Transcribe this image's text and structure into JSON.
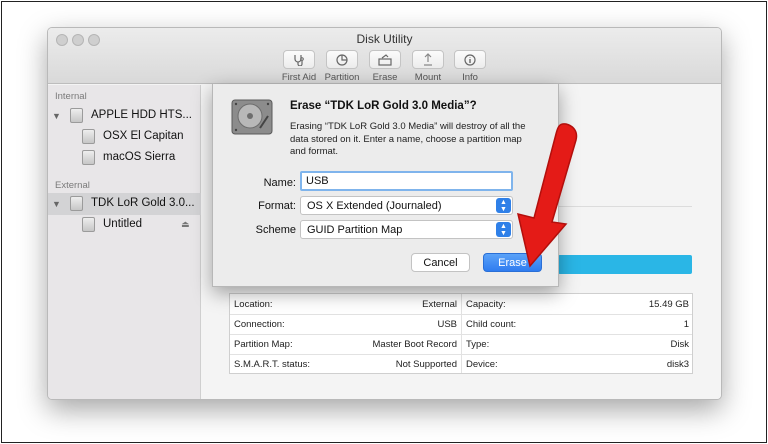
{
  "window": {
    "title": "Disk Utility"
  },
  "toolbar": {
    "buttons": [
      {
        "label": "First Aid",
        "icon": "stethoscope-icon"
      },
      {
        "label": "Partition",
        "icon": "pie-chart-icon"
      },
      {
        "label": "Erase",
        "icon": "erase-disk-icon"
      },
      {
        "label": "Mount",
        "icon": "mount-icon"
      },
      {
        "label": "Info",
        "icon": "info-icon"
      }
    ]
  },
  "sidebar": {
    "internal_header": "Internal",
    "external_header": "External",
    "items": [
      {
        "label": "APPLE HDD HTS..."
      },
      {
        "label": "OSX El Capitan"
      },
      {
        "label": "macOS Sierra"
      },
      {
        "label": "TDK LoR Gold 3.0..."
      },
      {
        "label": "Untitled"
      }
    ]
  },
  "dialog": {
    "title": "Erase “TDK LoR Gold 3.0 Media”?",
    "message": "Erasing “TDK LoR Gold 3.0 Media” will destroy of all the data stored on it. Enter a name, choose a partition map and format.",
    "name_label": "Name:",
    "name_value": "USB",
    "format_label": "Format:",
    "format_value": "OS X Extended (Journaled)",
    "scheme_label": "Scheme",
    "scheme_value": "GUID Partition Map",
    "cancel_label": "Cancel",
    "erase_label": "Erase"
  },
  "info": {
    "rows": [
      {
        "lk": "Location:",
        "lv": "External",
        "rk": "Capacity:",
        "rv": "15.49 GB"
      },
      {
        "lk": "Connection:",
        "lv": "USB",
        "rk": "Child count:",
        "rv": "1"
      },
      {
        "lk": "Partition Map:",
        "lv": "Master Boot Record",
        "rk": "Type:",
        "rv": "Disk"
      },
      {
        "lk": "S.M.A.R.T. status:",
        "lv": "Not Supported",
        "rk": "Device:",
        "rv": "disk3"
      }
    ]
  },
  "colors": {
    "accent_blue": "#2f7cf0",
    "usage_bar": "#2ab6e6",
    "annotation_arrow": "#e41b17"
  }
}
